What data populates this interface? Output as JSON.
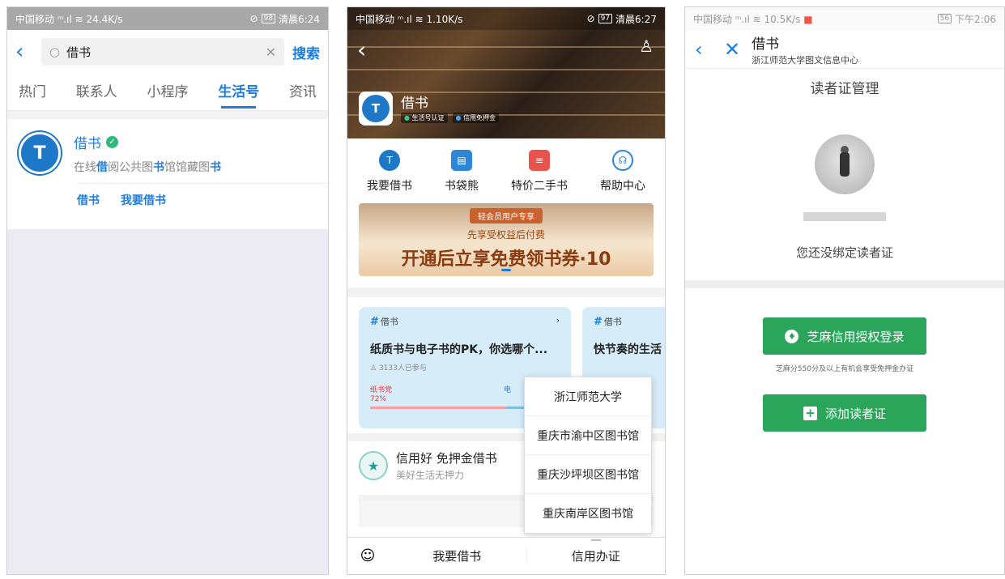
{
  "screen1": {
    "status": {
      "carrier": "中国移动",
      "speed": "24.4K/s",
      "battery": "98",
      "time": "清晨6:24"
    },
    "search": {
      "back_icon": "chevron-left-icon",
      "value": "借书",
      "button": "搜索"
    },
    "tabs": [
      {
        "label": "热门"
      },
      {
        "label": "联系人"
      },
      {
        "label": "小程序"
      },
      {
        "label": "生活号"
      },
      {
        "label": "资讯"
      }
    ],
    "active_tab": "生活号",
    "result": {
      "logo_text": "T",
      "title": "借书",
      "desc_a": "在线",
      "desc_b": "借",
      "desc_c": "阅公共图",
      "desc_d": "书",
      "desc_e": "馆馆藏图",
      "desc_f": "书",
      "link1": "借书",
      "link2": "我要借书"
    },
    "accent": "#1a7de1"
  },
  "screen2": {
    "status": {
      "carrier": "中国移动",
      "speed": "1.10K/s",
      "battery": "97",
      "time": "清晨6:27"
    },
    "header": {
      "name": "借书",
      "tag1": "生活号认证",
      "tag2": "信用免押金",
      "logo_text": "T"
    },
    "menu": [
      {
        "label": "我要借书",
        "icon": "logo-icon"
      },
      {
        "label": "书袋熊",
        "icon": "book-icon"
      },
      {
        "label": "特价二手书",
        "icon": "books-stack-icon"
      },
      {
        "label": "帮助中心",
        "icon": "headset-icon"
      }
    ],
    "banner": {
      "badge": "轻会员用户专享",
      "sub": "先享受权益后付费",
      "main": "开通后立享免费领书券·10"
    },
    "card1": {
      "tag": "借书",
      "title": "纸质书与电子书的PK，你选哪个...",
      "join": "3133人已参与",
      "vote_label": "纸书党",
      "vote_pct": "72%",
      "vote_side2": "电",
      "pct": 72
    },
    "card2": {
      "tag": "借书",
      "title": "快节奏的生活"
    },
    "credit": {
      "title": "信用好 免押金借书",
      "sub": "美好生活无押力"
    },
    "popup": [
      "浙江师范大学",
      "重庆市渝中区图书馆",
      "重庆沙坪坝区图书馆",
      "重庆南岸区图书馆"
    ],
    "bottombar": {
      "item1": "我要借书",
      "item2": "信用办证"
    }
  },
  "screen3": {
    "status": {
      "carrier": "中国移动",
      "speed": "10.5K/s",
      "battery": "56",
      "time": "下午2:06"
    },
    "nav": {
      "title": "借书",
      "subtitle": "浙江师范大学图文信息中心"
    },
    "heading": "读者证管理",
    "unbound": "您还没绑定读者证",
    "zhima_button": "芝麻信用授权登录",
    "zhima_hint": "芝麻分550分及以上有机会享受免押金办证",
    "add_button": "添加读者证",
    "green": "#2aa55a"
  }
}
